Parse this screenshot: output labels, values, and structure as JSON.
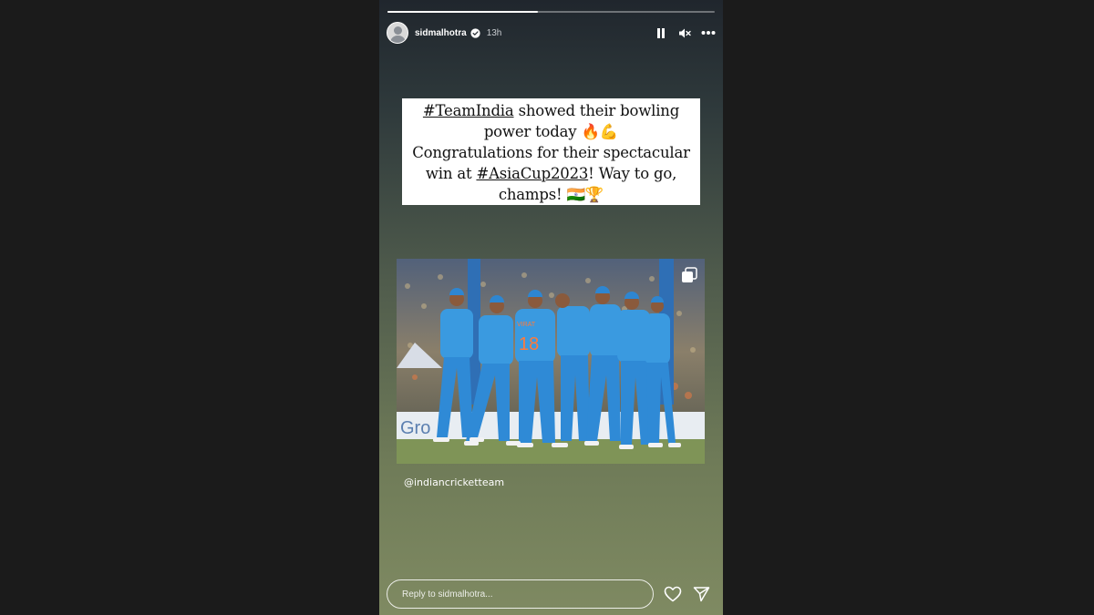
{
  "story": {
    "progress": 0.46,
    "username": "sidmalhotra",
    "verified": true,
    "time_ago": "13h",
    "icons": {
      "pause": "pause-icon",
      "mute": "speaker-muted-icon",
      "more": "more-horizontal-icon"
    },
    "text_card": {
      "line1_tag": "#TeamIndia",
      "line1_rest": " showed their bowling",
      "line2_text": "power today ",
      "line2_emoji": "🔥💪",
      "line3": "Congratulations for their spectacular",
      "line4_pre": "win at ",
      "line4_tag": "#AsiaCup2023",
      "line4_rest": "! Way to go,",
      "line5_text": "champs! ",
      "line5_emoji": "🇮🇳🏆"
    },
    "photo": {
      "jersey_number": "18",
      "jersey_name": "VIRAT",
      "banner_text": "Gro",
      "multi_icon": "multiple-photos-icon"
    },
    "mention": "@indiancricketteam",
    "reply_placeholder": "Reply to sidmalhotra...",
    "footer_icons": {
      "like": "heart-icon",
      "share": "send-icon"
    }
  }
}
